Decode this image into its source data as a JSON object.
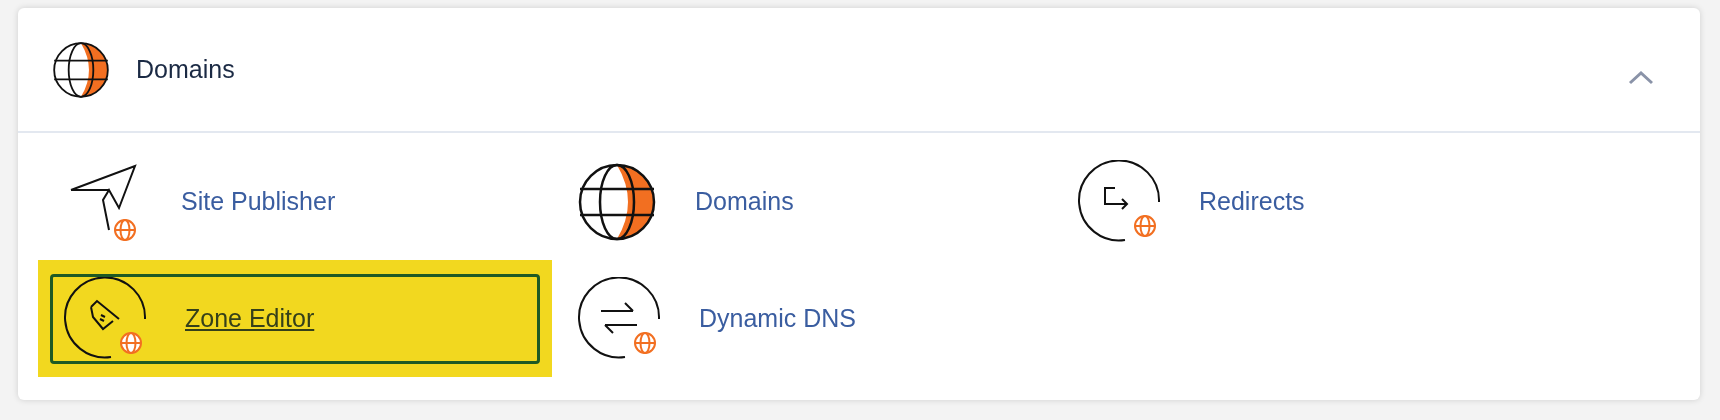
{
  "section": {
    "title": "Domains",
    "expanded": true
  },
  "items": [
    {
      "label": "Site Publisher",
      "kind": "publisher",
      "selected": false
    },
    {
      "label": "Domains",
      "kind": "domains",
      "selected": false
    },
    {
      "label": "Redirects",
      "kind": "redirects",
      "selected": false
    },
    {
      "label": "Zone Editor",
      "kind": "zone",
      "selected": true
    },
    {
      "label": "Dynamic DNS",
      "kind": "dns",
      "selected": false
    }
  ]
}
